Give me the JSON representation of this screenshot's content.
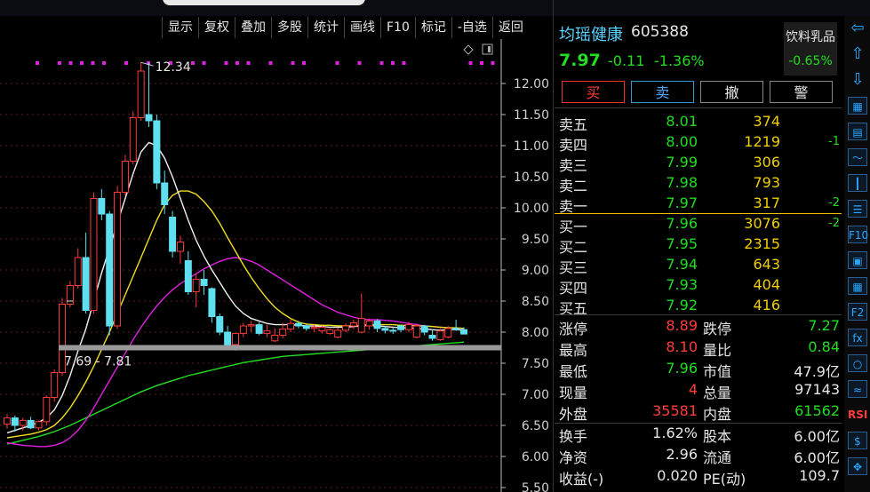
{
  "topbar": {
    "left_text": "",
    "mid_text": ""
  },
  "toolbar": [
    "显示",
    "复权",
    "叠加",
    "多股",
    "统计",
    "画线",
    "F10",
    "标记",
    "-自选",
    "返回"
  ],
  "stock": {
    "name": "均瑶健康",
    "code": "605388",
    "price": "7.97",
    "change": "-0.11",
    "change_pct": "-1.36%",
    "sector": "饮料乳品",
    "sector_pct": "-0.65%"
  },
  "trade_buttons": [
    "买",
    "卖",
    "撤",
    "警"
  ],
  "orderbook": {
    "asks": [
      {
        "label": "卖五",
        "price": "8.01",
        "vol": "374",
        "delta": ""
      },
      {
        "label": "卖四",
        "price": "8.00",
        "vol": "1219",
        "delta": "-1"
      },
      {
        "label": "卖三",
        "price": "7.99",
        "vol": "306",
        "delta": ""
      },
      {
        "label": "卖二",
        "price": "7.98",
        "vol": "793",
        "delta": ""
      },
      {
        "label": "卖一",
        "price": "7.97",
        "vol": "317",
        "delta": "-2"
      }
    ],
    "bids": [
      {
        "label": "买一",
        "price": "7.96",
        "vol": "3076",
        "delta": "-2"
      },
      {
        "label": "买二",
        "price": "7.95",
        "vol": "2315",
        "delta": ""
      },
      {
        "label": "买三",
        "price": "7.94",
        "vol": "643",
        "delta": ""
      },
      {
        "label": "买四",
        "price": "7.93",
        "vol": "404",
        "delta": ""
      },
      {
        "label": "买五",
        "price": "7.92",
        "vol": "416",
        "delta": ""
      }
    ]
  },
  "stats": [
    {
      "l1": "涨停",
      "v1": "8.89",
      "c1": "red",
      "l2": "跌停",
      "v2": "7.27",
      "c2": "green"
    },
    {
      "l1": "最高",
      "v1": "8.10",
      "c1": "red",
      "l2": "量比",
      "v2": "0.84",
      "c2": "green"
    },
    {
      "l1": "最低",
      "v1": "7.96",
      "c1": "green",
      "l2": "市值",
      "v2": "47.9亿",
      "c2": "white"
    },
    {
      "l1": "现量",
      "v1": "4",
      "c1": "red",
      "l2": "总量",
      "v2": "97143",
      "c2": "white"
    },
    {
      "l1": "外盘",
      "v1": "35581",
      "c1": "red",
      "l2": "内盘",
      "v2": "61562",
      "c2": "green"
    },
    {
      "l1": "换手",
      "v1": "1.62%",
      "c1": "white",
      "l2": "股本",
      "v2": "6.00亿",
      "c2": "white"
    },
    {
      "l1": "净资",
      "v1": "2.96",
      "c1": "white",
      "l2": "流通",
      "v2": "6.00亿",
      "c2": "white"
    },
    {
      "l1": "收益(-)",
      "v1": "0.020",
      "c1": "white",
      "l2": "PE(动)",
      "v2": "109.7",
      "c2": "white"
    }
  ],
  "chart_data": {
    "type": "candlestick",
    "y_ticks": [
      "12.00",
      "11.50",
      "11.00",
      "10.50",
      "10.00",
      "9.50",
      "9.00",
      "8.50",
      "8.00",
      "7.50",
      "7.00",
      "6.50",
      "6.00",
      "5.50"
    ],
    "ylim": [
      5.5,
      12.6
    ],
    "high_annotation": "12.34",
    "support_label": "7.69 - 7.81",
    "support_level": 7.75,
    "candles": [
      [
        6.52,
        6.68,
        6.45,
        6.62
      ],
      [
        6.62,
        6.66,
        6.4,
        6.5
      ],
      [
        6.5,
        6.62,
        6.42,
        6.58
      ],
      [
        6.58,
        6.64,
        6.44,
        6.46
      ],
      [
        6.46,
        6.58,
        6.42,
        6.56
      ],
      [
        6.56,
        6.98,
        6.5,
        6.95
      ],
      [
        6.95,
        7.4,
        6.88,
        7.35
      ],
      [
        7.35,
        8.55,
        7.3,
        8.45
      ],
      [
        8.45,
        8.82,
        8.4,
        8.75
      ],
      [
        8.75,
        9.35,
        8.7,
        9.2
      ],
      [
        9.2,
        9.6,
        8.3,
        8.35
      ],
      [
        8.35,
        10.25,
        8.3,
        10.15
      ],
      [
        10.15,
        10.3,
        9.8,
        9.9
      ],
      [
        9.9,
        9.95,
        7.95,
        8.1
      ],
      [
        8.1,
        10.35,
        8.05,
        10.25
      ],
      [
        10.25,
        10.85,
        10.2,
        10.75
      ],
      [
        10.75,
        11.55,
        10.7,
        11.45
      ],
      [
        11.45,
        12.34,
        11.4,
        12.2
      ],
      [
        11.5,
        12.34,
        11.3,
        11.4
      ],
      [
        11.4,
        11.5,
        10.3,
        10.4
      ],
      [
        10.4,
        10.6,
        9.9,
        10.05
      ],
      [
        9.85,
        9.95,
        9.2,
        9.3
      ],
      [
        9.3,
        9.55,
        9.1,
        9.45
      ],
      [
        9.15,
        9.3,
        8.6,
        8.65
      ],
      [
        8.65,
        8.95,
        8.4,
        8.85
      ],
      [
        8.85,
        9.0,
        8.6,
        8.75
      ],
      [
        8.7,
        8.72,
        8.15,
        8.25
      ],
      [
        8.25,
        8.3,
        7.95,
        8.0
      ],
      [
        8.0,
        8.1,
        7.75,
        7.8
      ],
      [
        7.8,
        7.85,
        7.7,
        7.98
      ],
      [
        7.98,
        8.15,
        7.92,
        8.1
      ],
      [
        8.1,
        8.18,
        8.0,
        8.12
      ],
      [
        8.12,
        8.16,
        7.95,
        7.98
      ],
      [
        7.98,
        8.12,
        7.92,
        8.02
      ],
      [
        7.86,
        8.06,
        7.84,
        7.95
      ],
      [
        7.95,
        8.15,
        7.9,
        8.05
      ],
      [
        8.05,
        8.2,
        8.0,
        8.14
      ],
      [
        8.14,
        8.18,
        8.06,
        8.1
      ],
      [
        8.1,
        8.14,
        8.02,
        8.06
      ],
      [
        8.06,
        8.12,
        8.0,
        8.08
      ],
      [
        8.02,
        8.1,
        7.98,
        8.08
      ],
      [
        7.98,
        8.06,
        7.96,
        8.04
      ],
      [
        7.92,
        8.07,
        7.9,
        8.03
      ],
      [
        8.03,
        8.14,
        8.0,
        8.1
      ],
      [
        8.1,
        8.2,
        8.05,
        8.15
      ],
      [
        8.0,
        8.62,
        7.98,
        8.22
      ],
      [
        8.1,
        8.22,
        8.04,
        8.18
      ],
      [
        8.18,
        8.21,
        8.0,
        8.06
      ],
      [
        8.06,
        8.1,
        7.98,
        8.03
      ],
      [
        8.03,
        8.08,
        7.97,
        8.02
      ],
      [
        8.1,
        8.12,
        8.0,
        8.04
      ],
      [
        8.04,
        8.16,
        8.0,
        8.12
      ],
      [
        7.92,
        8.14,
        7.9,
        8.1
      ],
      [
        8.1,
        8.12,
        7.95,
        8.0
      ],
      [
        7.95,
        8.05,
        7.86,
        7.9
      ],
      [
        7.88,
        8.06,
        7.86,
        8.02
      ],
      [
        7.92,
        8.1,
        7.9,
        8.06
      ],
      [
        8.06,
        8.2,
        8.02,
        8.04
      ],
      [
        8.04,
        8.08,
        7.96,
        7.97
      ]
    ],
    "ma_white": [
      6.38,
      6.42,
      6.46,
      6.5,
      6.55,
      6.62,
      6.75,
      6.98,
      7.3,
      7.7,
      8.05,
      8.5,
      8.95,
      9.35,
      9.75,
      10.15,
      10.55,
      10.9,
      11.05,
      11.0,
      10.8,
      10.5,
      10.15,
      9.8,
      9.48,
      9.22,
      9.0,
      8.8,
      8.6,
      8.42,
      8.3,
      8.22,
      8.18,
      8.14,
      8.12,
      8.12,
      8.12,
      8.11,
      8.1,
      8.1,
      8.09,
      8.08,
      8.08,
      8.08,
      8.09,
      8.1,
      8.11,
      8.1,
      8.09,
      8.08,
      8.07,
      8.07,
      8.06,
      8.05,
      8.04,
      8.03,
      8.04,
      8.04,
      8.03
    ],
    "ma_yellow": [
      6.3,
      6.32,
      6.34,
      6.36,
      6.39,
      6.43,
      6.5,
      6.62,
      6.78,
      6.98,
      7.2,
      7.45,
      7.72,
      8.0,
      8.3,
      8.6,
      8.9,
      9.2,
      9.5,
      9.8,
      10.05,
      10.2,
      10.27,
      10.27,
      10.22,
      10.1,
      9.95,
      9.75,
      9.52,
      9.3,
      9.08,
      8.88,
      8.7,
      8.54,
      8.4,
      8.3,
      8.22,
      8.16,
      8.13,
      8.12,
      8.11,
      8.11,
      8.1,
      8.1,
      8.1,
      8.11,
      8.12,
      8.12,
      8.12,
      8.12,
      8.11,
      8.11,
      8.1,
      8.1,
      8.09,
      8.08,
      8.07,
      8.07,
      8.06
    ],
    "ma_magenta": [
      6.22,
      6.2,
      6.18,
      6.17,
      6.16,
      6.16,
      6.18,
      6.22,
      6.3,
      6.42,
      6.58,
      6.78,
      7.0,
      7.22,
      7.44,
      7.66,
      7.88,
      8.08,
      8.26,
      8.42,
      8.56,
      8.68,
      8.78,
      8.86,
      8.94,
      9.02,
      9.08,
      9.14,
      9.18,
      9.2,
      9.18,
      9.14,
      9.08,
      9.0,
      8.92,
      8.84,
      8.76,
      8.68,
      8.6,
      8.52,
      8.44,
      8.38,
      8.32,
      8.28,
      8.24,
      8.21,
      8.2,
      8.2,
      8.19,
      8.18,
      8.16,
      8.14,
      8.12,
      8.1,
      8.09,
      8.08,
      8.07,
      8.06,
      8.05
    ],
    "ma_green": [
      6.2,
      6.23,
      6.26,
      6.29,
      6.32,
      6.36,
      6.4,
      6.45,
      6.5,
      6.56,
      6.62,
      6.68,
      6.74,
      6.8,
      6.86,
      6.92,
      6.98,
      7.04,
      7.09,
      7.14,
      7.18,
      7.22,
      7.26,
      7.3,
      7.33,
      7.36,
      7.39,
      7.42,
      7.45,
      7.48,
      7.51,
      7.53,
      7.55,
      7.57,
      7.59,
      7.61,
      7.62,
      7.63,
      7.64,
      7.65,
      7.66,
      7.67,
      7.68,
      7.69,
      7.7,
      7.71,
      7.72,
      7.73,
      7.74,
      7.75,
      7.76,
      7.77,
      7.78,
      7.79,
      7.8,
      7.81,
      7.82,
      7.83,
      7.84
    ],
    "marker_dots": [
      0,
      2,
      3,
      4,
      5,
      6,
      8,
      10,
      12,
      14,
      15,
      17,
      18,
      19,
      21,
      23,
      24,
      27,
      29,
      31,
      32,
      33,
      39,
      40,
      41
    ]
  },
  "sidebar_icons": [
    "arrow-left-icon",
    "arrow-up-icon",
    "arrow-down-icon",
    "grid-icon",
    "table-icon",
    "line-chart-icon",
    "candle-icon",
    "list-icon",
    "f10-icon",
    "doc-icon",
    "calendar-icon",
    "f2-icon",
    "fx-icon",
    "circle-icon",
    "wave-icon",
    "rsi-icon",
    "dollar-icon",
    "crosshair-icon"
  ]
}
